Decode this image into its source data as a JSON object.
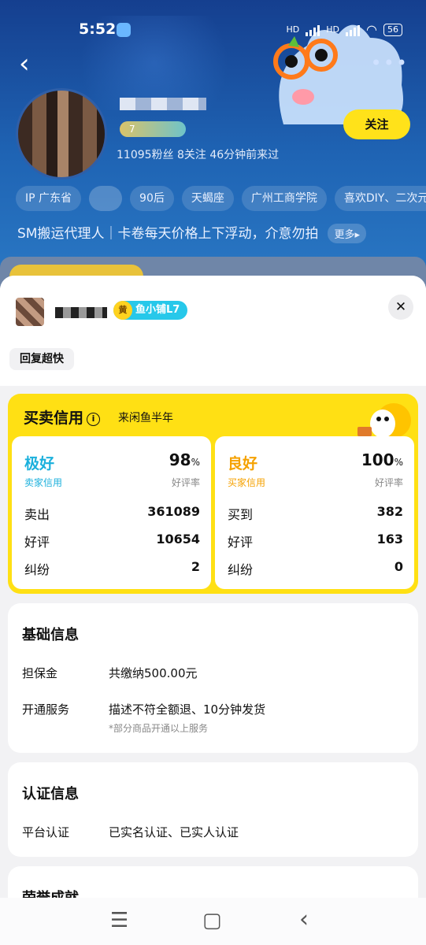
{
  "status_bar": {
    "time": "5:52",
    "battery": "56"
  },
  "profile": {
    "badge_level": "7",
    "stats": "11095粉丝  8关注  46分钟前来过",
    "follow_label": "关注",
    "tags": [
      "IP 广东省",
      "90后",
      "天蝎座",
      "广州工商学院",
      "喜欢DIY、二次元"
    ],
    "bio": "SM搬运代理人｜卡卷每天价格上下浮动，介意勿拍",
    "more_label": "更多▸"
  },
  "sheet": {
    "shop_level": "鱼小铺L7",
    "shop_level_icon": "黄",
    "close_label": "✕",
    "reply_tag": "回复超快",
    "credit": {
      "title": "买卖信用",
      "since": "来闲鱼半年",
      "seller": {
        "grade": "极好",
        "grade_sub": "卖家信用",
        "rate": "98",
        "rate_unit": "%",
        "rate_sub": "好评率",
        "rows": [
          {
            "k": "卖出",
            "v": "361089"
          },
          {
            "k": "好评",
            "v": "10654"
          },
          {
            "k": "纠纷",
            "v": "2"
          }
        ]
      },
      "buyer": {
        "grade": "良好",
        "grade_sub": "买家信用",
        "rate": "100",
        "rate_unit": "%",
        "rate_sub": "好评率",
        "rows": [
          {
            "k": "买到",
            "v": "382"
          },
          {
            "k": "好评",
            "v": "163"
          },
          {
            "k": "纠纷",
            "v": "0"
          }
        ]
      },
      "colors": {
        "seller": "#1bb0dc",
        "buyer": "#f5a100",
        "panel": "#ffe014"
      }
    },
    "basic": {
      "title": "基础信息",
      "deposit_k": "担保金",
      "deposit_v": "共缴纳500.00元",
      "service_k": "开通服务",
      "service_v": "描述不符全额退、10分钟发货",
      "service_note": "*部分商品开通以上服务"
    },
    "cert": {
      "title": "认证信息",
      "platform_k": "平台认证",
      "platform_v": "已实名认证、已实人认证"
    },
    "honor": {
      "title": "荣誉成就"
    }
  },
  "nav": {
    "menu": "☰",
    "home": "▢",
    "back": "‹"
  }
}
